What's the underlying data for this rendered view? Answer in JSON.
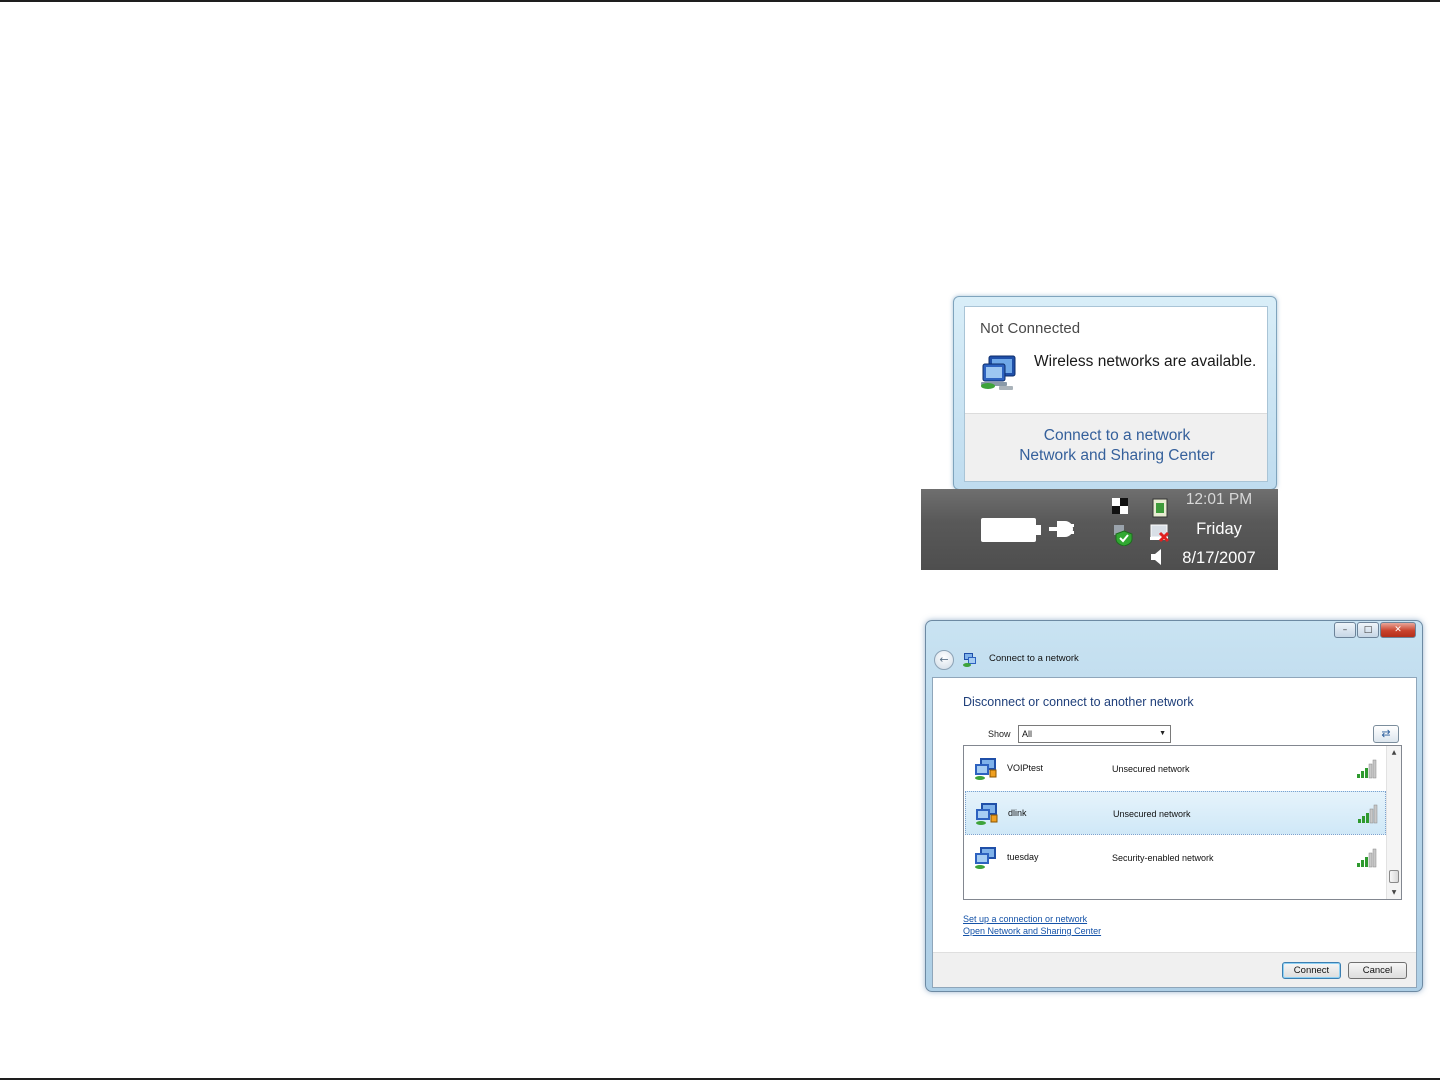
{
  "tray_popup": {
    "title": "Not Connected",
    "message": "Wireless networks are available.",
    "links": [
      "Connect to a network",
      "Network and Sharing Center"
    ],
    "clock": {
      "time": "12:01 PM",
      "day": "Friday",
      "date": "8/17/2007"
    },
    "icons": [
      "wireless-network-icon",
      "battery-icon",
      "power-plug-icon",
      "tray-app-icon",
      "clipboard-icon",
      "security-shield-icon",
      "network-disconnected-icon",
      "speaker-icon"
    ]
  },
  "connect_window": {
    "title": "Connect to a network",
    "heading": "Disconnect or connect to another network",
    "show_label": "Show",
    "show_value": "All",
    "networks": [
      {
        "name": "VOIPtest",
        "status": "Unsecured network",
        "selected": false,
        "signal_bars": 5
      },
      {
        "name": "dlink",
        "status": "Unsecured network",
        "selected": true,
        "signal_bars": 5
      },
      {
        "name": "tuesday",
        "status": "Security-enabled network",
        "selected": false,
        "signal_bars": 5
      }
    ],
    "links": [
      "Set up a connection or network",
      "Open Network and Sharing Center"
    ],
    "buttons": {
      "connect": "Connect",
      "cancel": "Cancel"
    },
    "colors": {
      "heading": "#1f3f7a",
      "link": "#1553a8",
      "selected_row": "#cfe8f7"
    }
  }
}
